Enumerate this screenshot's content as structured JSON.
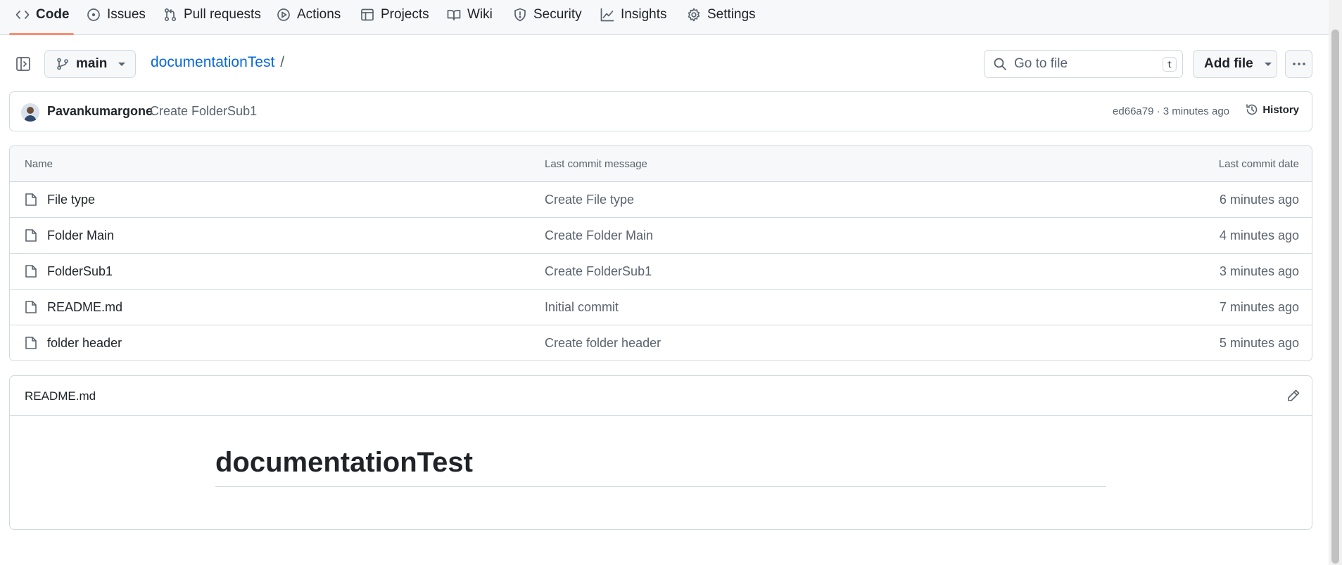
{
  "nav": {
    "tabs": [
      {
        "label": "Code",
        "icon": "code-icon"
      },
      {
        "label": "Issues",
        "icon": "issue-icon"
      },
      {
        "label": "Pull requests",
        "icon": "pull-request-icon"
      },
      {
        "label": "Actions",
        "icon": "play-icon"
      },
      {
        "label": "Projects",
        "icon": "table-icon"
      },
      {
        "label": "Wiki",
        "icon": "book-icon"
      },
      {
        "label": "Security",
        "icon": "shield-icon"
      },
      {
        "label": "Insights",
        "icon": "graph-icon"
      },
      {
        "label": "Settings",
        "icon": "gear-icon"
      }
    ],
    "active_tab": "Code",
    "accent_color": "#fd8c73"
  },
  "toolbar": {
    "branch": "main",
    "repo_name": "documentationTest",
    "path_separator": "/",
    "search_placeholder": "Go to file",
    "search_shortcut": "t",
    "add_file_label": "Add file"
  },
  "commit": {
    "author": "Pavankumargone",
    "message": "Create FolderSub1",
    "meta": "ed66a79 · 3 minutes ago",
    "history_label": "History"
  },
  "files": {
    "headers": {
      "name": "Name",
      "message": "Last commit message",
      "date": "Last commit date"
    },
    "rows": [
      {
        "name": "File type",
        "message": "Create File type",
        "date": "6 minutes ago"
      },
      {
        "name": "Folder Main",
        "message": "Create Folder Main",
        "date": "4 minutes ago"
      },
      {
        "name": "FolderSub1",
        "message": "Create FolderSub1",
        "date": "3 minutes ago"
      },
      {
        "name": "README.md",
        "message": "Initial commit",
        "date": "7 minutes ago"
      },
      {
        "name": "folder header",
        "message": "Create folder header",
        "date": "5 minutes ago"
      }
    ]
  },
  "readme": {
    "filename": "README.md",
    "heading": "documentationTest"
  },
  "colors": {
    "link": "#0969da",
    "border": "#d1d9e0",
    "muted": "#59636e"
  }
}
